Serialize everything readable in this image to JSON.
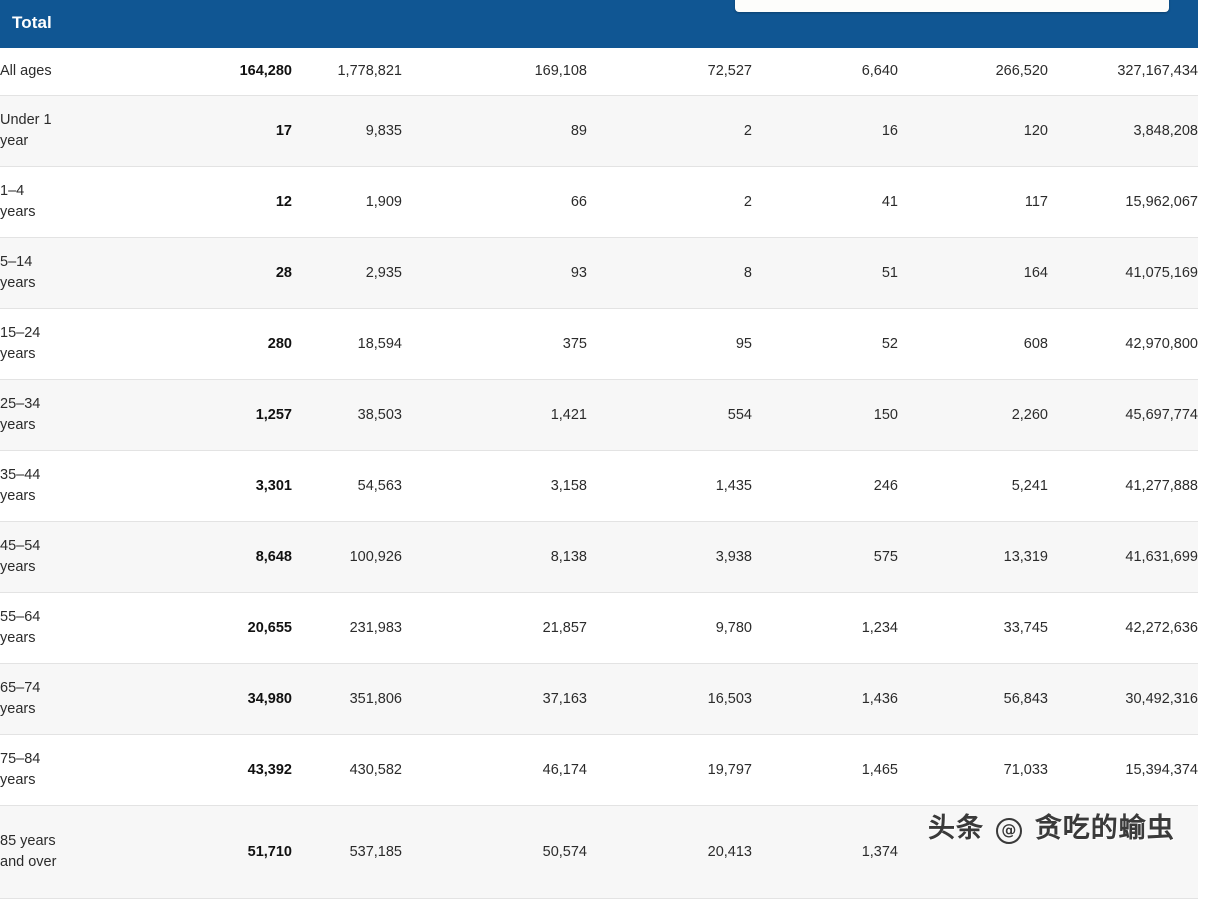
{
  "header": {
    "title": "Total",
    "search_box": "",
    "brand_color": "#105693"
  },
  "table": {
    "row_label_header": "",
    "rows": [
      {
        "label": "All ages",
        "values": [
          "164,280",
          "1,778,821",
          "169,108",
          "72,527",
          "6,640",
          "266,520",
          "327,167,434"
        ]
      },
      {
        "label": "Under 1 year",
        "values": [
          "17",
          "9,835",
          "89",
          "2",
          "16",
          "120",
          "3,848,208"
        ]
      },
      {
        "label": "1–4 years",
        "values": [
          "12",
          "1,909",
          "66",
          "2",
          "41",
          "117",
          "15,962,067"
        ]
      },
      {
        "label": "5–14 years",
        "values": [
          "28",
          "2,935",
          "93",
          "8",
          "51",
          "164",
          "41,075,169"
        ]
      },
      {
        "label": "15–24 years",
        "values": [
          "280",
          "18,594",
          "375",
          "95",
          "52",
          "608",
          "42,970,800"
        ]
      },
      {
        "label": "25–34 years",
        "values": [
          "1,257",
          "38,503",
          "1,421",
          "554",
          "150",
          "2,260",
          "45,697,774"
        ]
      },
      {
        "label": "35–44 years",
        "values": [
          "3,301",
          "54,563",
          "3,158",
          "1,435",
          "246",
          "5,241",
          "41,277,888"
        ]
      },
      {
        "label": "45–54 years",
        "values": [
          "8,648",
          "100,926",
          "8,138",
          "3,938",
          "575",
          "13,319",
          "41,631,699"
        ]
      },
      {
        "label": "55–64 years",
        "values": [
          "20,655",
          "231,983",
          "21,857",
          "9,780",
          "1,234",
          "33,745",
          "42,272,636"
        ]
      },
      {
        "label": "65–74 years",
        "values": [
          "34,980",
          "351,806",
          "37,163",
          "16,503",
          "1,436",
          "56,843",
          "30,492,316"
        ]
      },
      {
        "label": "75–84 years",
        "values": [
          "43,392",
          "430,582",
          "46,174",
          "19,797",
          "1,465",
          "71,033",
          "15,394,374"
        ]
      },
      {
        "label": "85 years and over",
        "values": [
          "51,710",
          "537,185",
          "50,574",
          "20,413",
          "1,374",
          "",
          ""
        ]
      }
    ]
  },
  "watermark": {
    "prefix": "头条",
    "at": "@",
    "name": "贪吃的蝓虫"
  }
}
